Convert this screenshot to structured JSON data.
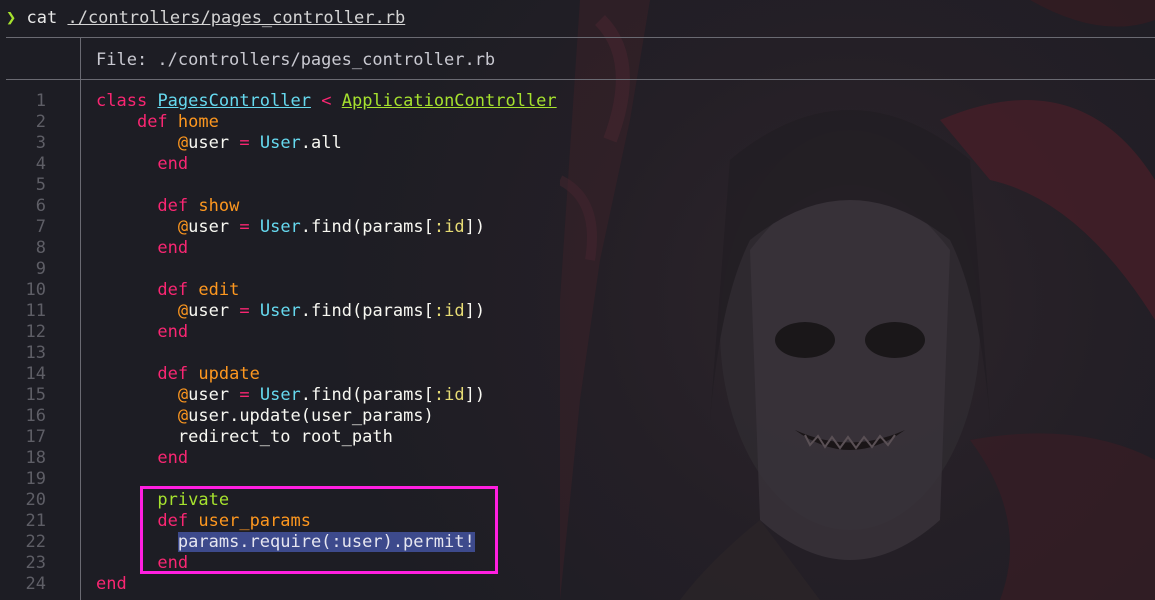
{
  "prompt": {
    "symbol": "❯",
    "command": "cat",
    "argument": "./controllers/pages_controller.rb"
  },
  "file_header": "File: ./controllers/pages_controller.rb",
  "lines": [
    {
      "n": "1"
    },
    {
      "n": "2"
    },
    {
      "n": "3"
    },
    {
      "n": "4"
    },
    {
      "n": "5"
    },
    {
      "n": "6"
    },
    {
      "n": "7"
    },
    {
      "n": "8"
    },
    {
      "n": "9"
    },
    {
      "n": "10"
    },
    {
      "n": "11"
    },
    {
      "n": "12"
    },
    {
      "n": "13"
    },
    {
      "n": "14"
    },
    {
      "n": "15"
    },
    {
      "n": "16"
    },
    {
      "n": "17"
    },
    {
      "n": "18"
    },
    {
      "n": "19"
    },
    {
      "n": "20"
    },
    {
      "n": "21"
    },
    {
      "n": "22"
    },
    {
      "n": "23"
    },
    {
      "n": "24"
    }
  ],
  "code": {
    "l1": {
      "kw": "class",
      "cls": "PagesController",
      "op": "<",
      "parent": "ApplicationController"
    },
    "l2": {
      "indent": "    ",
      "kw": "def",
      "fn": "home"
    },
    "l3": {
      "indent": "        ",
      "at": "@",
      "ivar": "user",
      "op": "=",
      "cls": "User",
      "rest": ".all"
    },
    "l4": {
      "indent": "      ",
      "kw": "end"
    },
    "l6": {
      "indent": "      ",
      "kw": "def",
      "fn": "show"
    },
    "l7": {
      "indent": "        ",
      "at": "@",
      "ivar": "user",
      "op": "=",
      "cls": "User",
      "pre": ".find(params[",
      "sym": ":id",
      "post": "])"
    },
    "l8": {
      "indent": "      ",
      "kw": "end"
    },
    "l10": {
      "indent": "      ",
      "kw": "def",
      "fn": "edit"
    },
    "l11": {
      "indent": "        ",
      "at": "@",
      "ivar": "user",
      "op": "=",
      "cls": "User",
      "pre": ".find(params[",
      "sym": ":id",
      "post": "])"
    },
    "l12": {
      "indent": "      ",
      "kw": "end"
    },
    "l14": {
      "indent": "      ",
      "kw": "def",
      "fn": "update"
    },
    "l15": {
      "indent": "        ",
      "at": "@",
      "ivar": "user",
      "op": "=",
      "cls": "User",
      "pre": ".find(params[",
      "sym": ":id",
      "post": "])"
    },
    "l16": {
      "indent": "        ",
      "at": "@",
      "rest": "user.update(user_params)"
    },
    "l17": {
      "indent": "        ",
      "rest": "redirect_to root_path"
    },
    "l18": {
      "indent": "      ",
      "kw": "end"
    },
    "l20": {
      "indent": "      ",
      "priv": "private"
    },
    "l21": {
      "indent": "      ",
      "kw": "def",
      "fn": "user_params"
    },
    "l22": {
      "indent": "        ",
      "selected": "params.require(:user).permit!"
    },
    "l23": {
      "indent": "      ",
      "kw": "end"
    },
    "l24": {
      "kw": "end"
    }
  },
  "colors": {
    "keyword": "#f92672",
    "function": "#fd971f",
    "constant": "#66d9ef",
    "inherited": "#a6e22e",
    "highlight_box": "#ff1fe0",
    "selection": "#3d4a8c"
  }
}
